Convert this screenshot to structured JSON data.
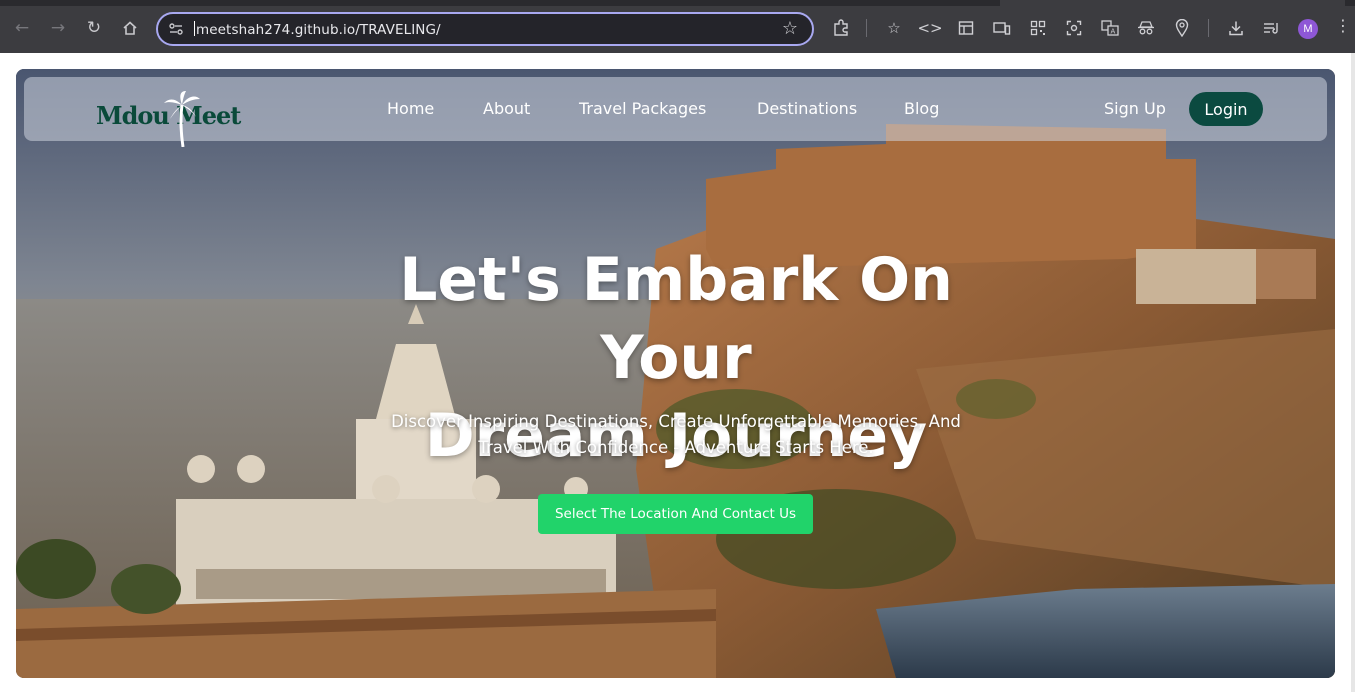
{
  "browser": {
    "url": "meetshah274.github.io/TRAVELING/",
    "back_icon": "arrow-left-icon",
    "forward_icon": "arrow-right-icon",
    "reload_icon": "reload-icon",
    "home_icon": "home-icon",
    "profile_initial": "M",
    "accent": "#a8a8f0"
  },
  "site": {
    "logo_text": "Mdou Meet",
    "nav": [
      {
        "label": "Home"
      },
      {
        "label": "About"
      },
      {
        "label": "Travel Packages"
      },
      {
        "label": "Destinations"
      },
      {
        "label": "Blog"
      }
    ],
    "signup_label": "Sign Up",
    "login_label": "Login",
    "login_color": "#0b4a40"
  },
  "hero": {
    "title_line1": "Let's Embark On Your",
    "title_line2": "Dream Journey",
    "subtitle_line1": "Discover Inspiring Destinations, Create Unforgettable Memories, And",
    "subtitle_line2": "Travel With Confidence - Adventure Starts Here.",
    "cta_label": "Select The Location And Contact Us",
    "cta_color": "#21d36a"
  }
}
